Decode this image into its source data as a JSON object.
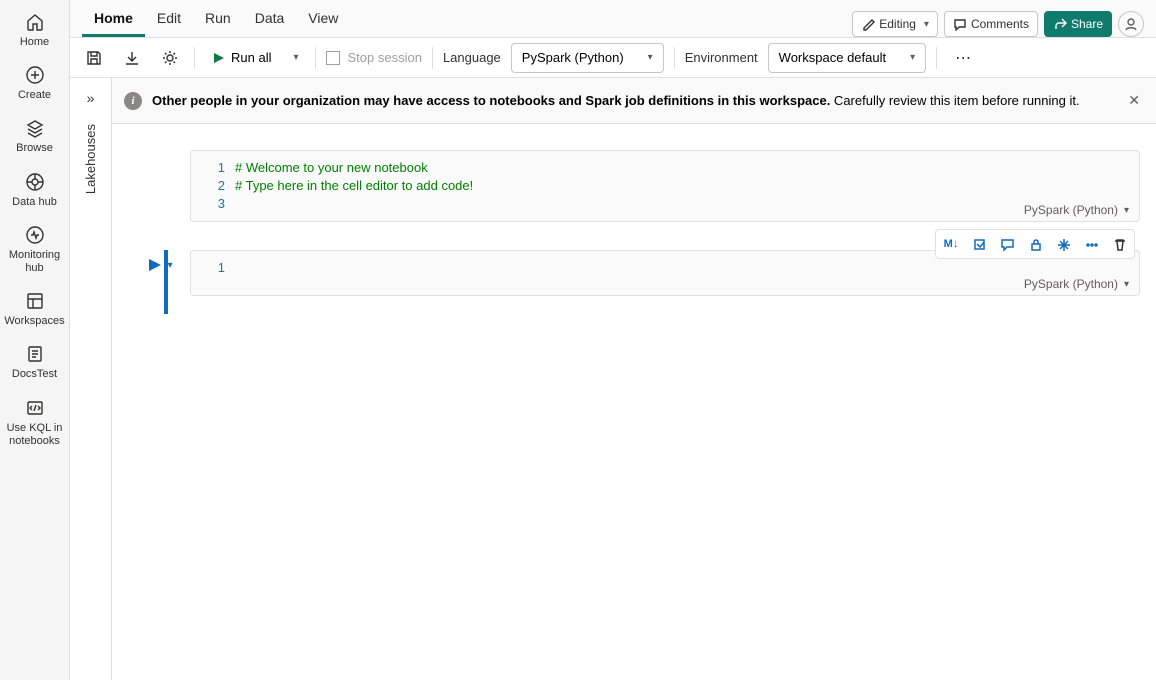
{
  "rail": {
    "home": "Home",
    "create": "Create",
    "browse": "Browse",
    "datahub": "Data hub",
    "monitoring": "Monitoring hub",
    "workspaces": "Workspaces",
    "docs": "DocsTest",
    "kql": "Use KQL in notebooks"
  },
  "tabs": {
    "home": "Home",
    "edit": "Edit",
    "run": "Run",
    "data": "Data",
    "view": "View"
  },
  "top": {
    "editing": "Editing",
    "comments": "Comments",
    "share": "Share"
  },
  "toolbar": {
    "runall": "Run all",
    "stop": "Stop session",
    "language": "Language",
    "langsel": "PySpark (Python)",
    "env": "Environment",
    "envsel": "Workspace default"
  },
  "side": {
    "label": "Lakehouses"
  },
  "info": {
    "bold": "Other people in your organization may have access to notebooks and Spark job definitions in this workspace.",
    "rest": " Carefully review this item before running it."
  },
  "cell1": {
    "line1": "# Welcome to your new notebook",
    "line2": "# Type here in the cell editor to add code!",
    "lang": "PySpark (Python)"
  },
  "cell2": {
    "lang": "PySpark (Python)"
  },
  "celltb": {
    "md": "M↓"
  }
}
